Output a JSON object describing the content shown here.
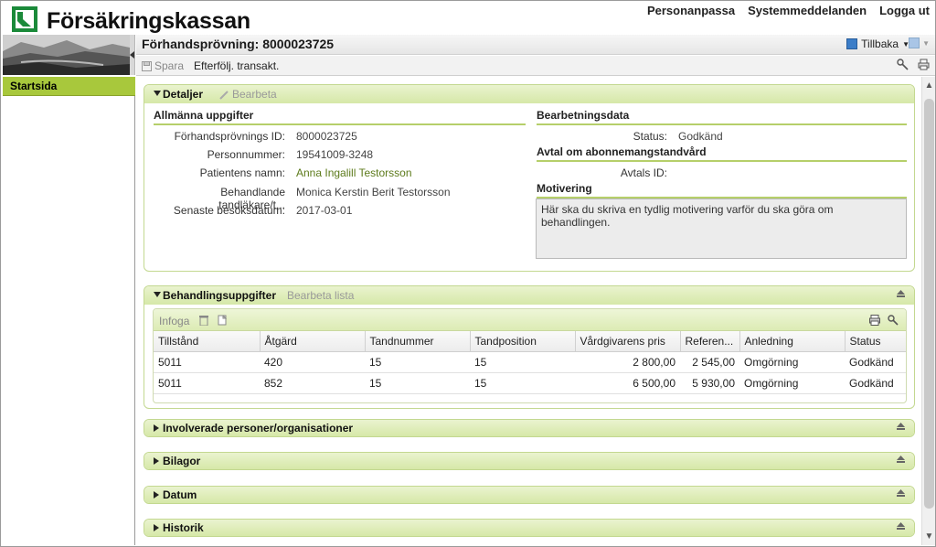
{
  "app": {
    "brand": "Försäkringskassan",
    "top_links": [
      "Personanpassa",
      "Systemmeddelanden",
      "Logga ut"
    ]
  },
  "nav": {
    "items": [
      {
        "label": "Startsida",
        "active": true
      }
    ]
  },
  "title_bar": {
    "title": "Förhandsprövning: 8000023725",
    "back_label": "Tillbaka"
  },
  "toolbar": {
    "save_label": "Spara",
    "follow_label": "Efterfölj. transakt."
  },
  "details": {
    "header": "Detaljer",
    "edit_label": "Bearbeta",
    "general": {
      "title": "Allmänna uppgifter",
      "fields": [
        {
          "label": "Förhandsprövnings ID:",
          "value": "8000023725"
        },
        {
          "label": "Personnummer:",
          "value": "19541009-3248"
        },
        {
          "label": "Patientens namn:",
          "value": "Anna Ingalill Testorsson"
        },
        {
          "label": "Behandlande tandläkare/t...",
          "value": "Monica Kerstin Berit Testorsson"
        },
        {
          "label": "Senaste besöksdatum:",
          "value": "2017-03-01"
        }
      ]
    },
    "processing": {
      "title": "Bearbetningsdata",
      "status_label": "Status:",
      "status_value": "Godkänd"
    },
    "agreement": {
      "title": "Avtal om abonnemangstandvård",
      "id_label": "Avtals ID:",
      "id_value": ""
    },
    "motivation": {
      "title": "Motivering",
      "text": "Här ska du skriva en tydlig motivering varför du ska göra om behandlingen."
    }
  },
  "treatment": {
    "header": "Behandlingsuppgifter",
    "edit_label": "Bearbeta lista",
    "insert_label": "Infoga",
    "columns": [
      "Tillstånd",
      "Åtgärd",
      "Tandnummer",
      "Tandposition",
      "Vårdgivarens pris",
      "Referen...",
      "Anledning",
      "Status"
    ],
    "rows": [
      [
        "5011",
        "420",
        "15",
        "15",
        "2 800,00",
        "2 545,00",
        "Omgörning",
        "Godkänd"
      ],
      [
        "5011",
        "852",
        "15",
        "15",
        "6 500,00",
        "5 930,00",
        "Omgörning",
        "Godkänd"
      ]
    ]
  },
  "collapsed_sections": [
    "Involverade personer/organisationer",
    "Bilagor",
    "Datum",
    "Historik"
  ]
}
